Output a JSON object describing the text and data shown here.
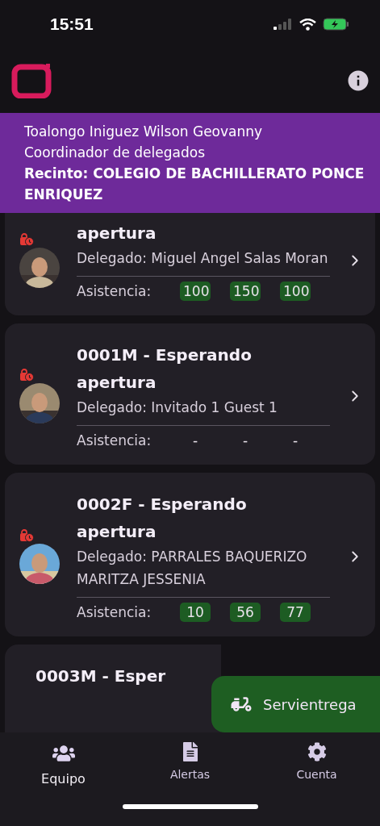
{
  "status_bar": {
    "time": "15:51"
  },
  "banner": {
    "name": "Toalongo Iniguez Wilson Geovanny",
    "role": "Coordinador de delegados",
    "venue": "Recinto: COLEGIO DE BACHILLERATO PONCE ENRIQUEZ"
  },
  "cards": [
    {
      "title": "apertura",
      "delegate": "Delegado: Miguel Angel Salas Moran",
      "attendance_label": "Asistencia:",
      "attendance": [
        {
          "value": "100",
          "recorded": true
        },
        {
          "value": "150",
          "recorded": true
        },
        {
          "value": "100",
          "recorded": true
        }
      ],
      "avatar": {
        "kind": "picture"
      }
    },
    {
      "title": "0001M - Esperando apertura",
      "delegate": "Delegado: Invitado 1 Guest 1",
      "attendance_label": "Asistencia:",
      "attendance": [
        {
          "value": "-",
          "recorded": false
        },
        {
          "value": "-",
          "recorded": false
        },
        {
          "value": "-",
          "recorded": false
        }
      ],
      "avatar": {
        "kind": "picture"
      }
    },
    {
      "title": "0002F - Esperando apertura",
      "delegate": "Delegado: PARRALES BAQUERIZO MARITZA JESSENIA",
      "attendance_label": "Asistencia:",
      "attendance": [
        {
          "value": "10",
          "recorded": true
        },
        {
          "value": "56",
          "recorded": true
        },
        {
          "value": "77",
          "recorded": true
        }
      ],
      "avatar": {
        "kind": "picture"
      }
    },
    {
      "title": "0003M - Esper"
    }
  ],
  "fab": {
    "label": "Servientrega"
  },
  "nav": [
    {
      "label": "Equipo",
      "selected": true,
      "kind": "team"
    },
    {
      "label": "Alertas",
      "selected": false,
      "kind": "doc"
    },
    {
      "label": "Cuenta",
      "selected": false,
      "kind": "gear"
    }
  ]
}
